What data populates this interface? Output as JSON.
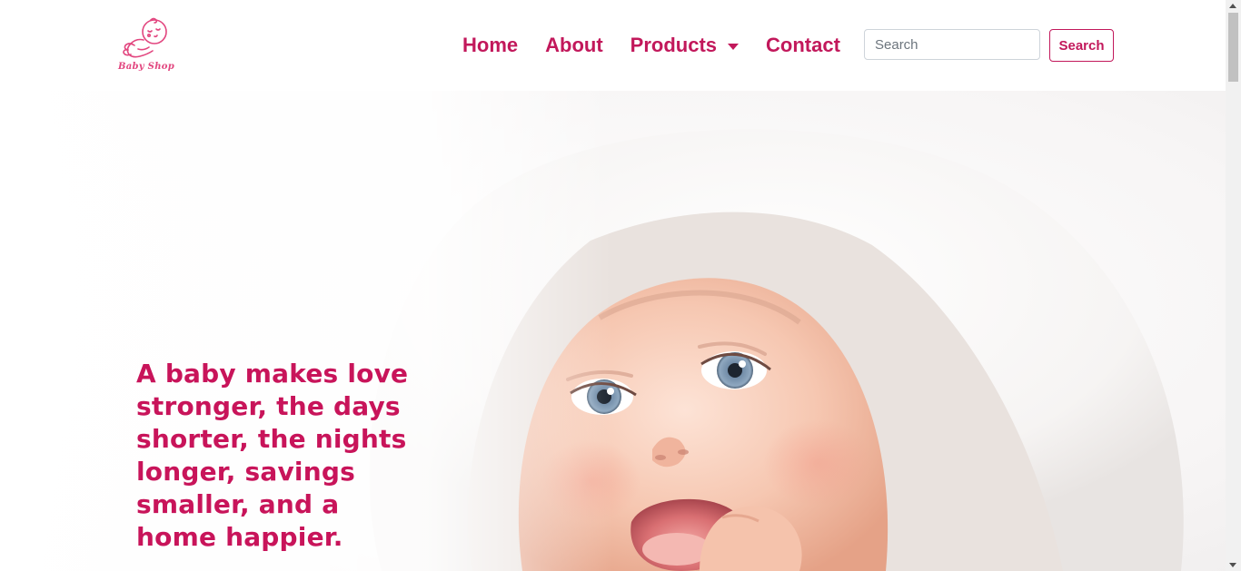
{
  "brand": {
    "logo_text": "Baby Shop",
    "logo_icon": "sleeping-baby-icon",
    "color": "#e2467f"
  },
  "nav": {
    "items": [
      {
        "label": "Home"
      },
      {
        "label": "About"
      },
      {
        "label": "Products",
        "has_dropdown": true
      },
      {
        "label": "Contact"
      }
    ],
    "color": "#c2185b"
  },
  "search": {
    "placeholder": "Search",
    "value": "",
    "button_label": "Search"
  },
  "hero": {
    "quote": "A baby makes love stronger, the days shorter, the nights longer, savings smaller, and a home happier.",
    "image": "smiling-baby-in-white-towel",
    "quote_color": "#c8145a"
  }
}
